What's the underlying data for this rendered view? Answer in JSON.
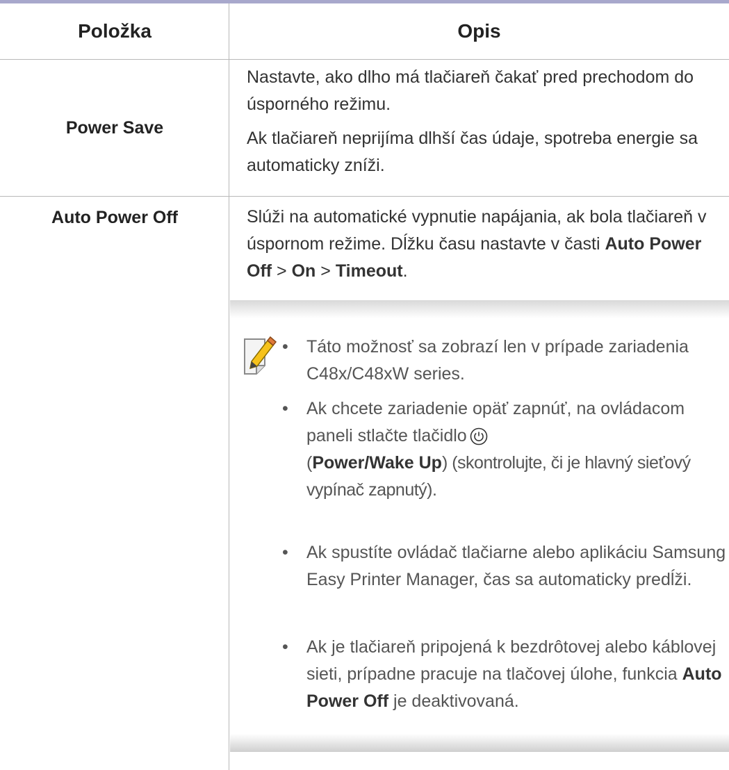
{
  "table": {
    "header": {
      "col1": "Položka",
      "col2": "Opis"
    },
    "rows": [
      {
        "label": "Power Save",
        "paragraphs": [
          "Nastavte, ako dlho má tlačiareň čakať pred prechodom do úsporného režimu.",
          "Ak tlačiareň neprijíma dlhší čas údaje, spotreba energie sa automaticky zníži."
        ]
      },
      {
        "label": "Auto Power Off",
        "intro_prefix": "Slúži na automatické vypnutie napájania, ak bola tlačiareň v úspornom režime. Dĺžku času nastavte v časti ",
        "intro_b1": "Auto Power Off",
        "intro_sep1": " > ",
        "intro_b2": "On",
        "intro_sep2": " > ",
        "intro_b3": "Timeout",
        "intro_end": "."
      }
    ]
  },
  "note": {
    "icon": "note-pencil-icon",
    "bullets": [
      {
        "text": "Táto možnosť sa zobrazí len v prípade zariadenia C48x/C48xW series."
      },
      {
        "text_a": "Ak chcete zariadenie opäť zapnúť, na ovládacom paneli stlačte tlačidlo",
        "icon": "power-icon",
        "text_b_open": "(",
        "text_b_bold": "Power/Wake Up",
        "text_b_rest": ") (skontrolujte, či je hlavný sieťový vypínač zapnutý)."
      },
      {
        "text": "Ak spustíte ovládač tlačiarne alebo aplikáciu Samsung Easy Printer Manager, čas sa automaticky predĺži."
      },
      {
        "text_a": "Ak je tlačiareň pripojená k bezdrôtovej alebo káblovej sieti, prípadne pracuje na tlačovej úlohe, funkcia ",
        "text_bold": "Auto Power Off",
        "text_c": " je deaktivovaná."
      }
    ]
  }
}
